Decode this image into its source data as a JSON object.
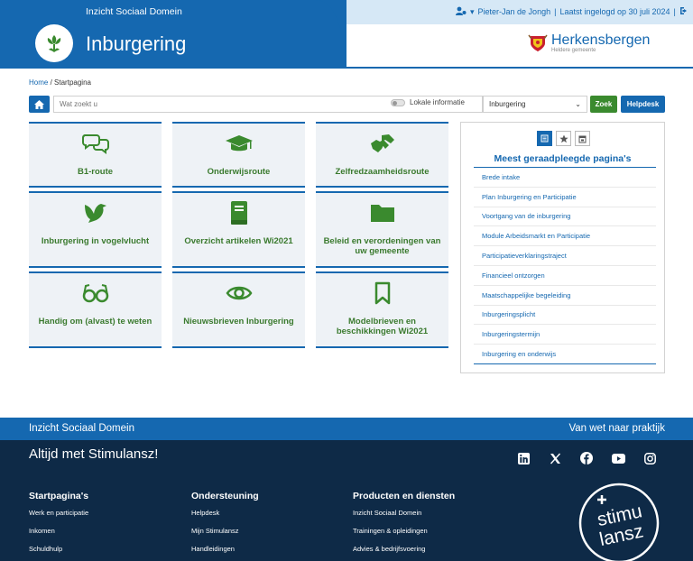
{
  "header": {
    "brand_top": "Inzicht Sociaal Domein",
    "app_title": "Inburgering",
    "user": "Pieter-Jan de Jongh",
    "separator": "|",
    "last_login": "Laatst ingelogd op 30 juli 2024",
    "municipality": "Herkensbergen",
    "municipality_tagline": "Heldere gemeente"
  },
  "breadcrumb": {
    "home": "Home",
    "sep": "/",
    "current": "Startpagina"
  },
  "search": {
    "placeholder": "Wat zoekt u",
    "toggle_label": "Lokale informatie",
    "select_value": "Inburgering",
    "search_button": "Zoek",
    "help_button": "Helpdesk"
  },
  "tiles": [
    {
      "label": "B1-route",
      "icon": "chat-icon"
    },
    {
      "label": "Onderwijsroute",
      "icon": "graduation-cap-icon"
    },
    {
      "label": "Zelfredzaamheidsroute",
      "icon": "handshake-icon"
    },
    {
      "label": "Inburgering in vogelvlucht",
      "icon": "dove-icon"
    },
    {
      "label": "Overzicht artikelen Wi2021",
      "icon": "book-icon"
    },
    {
      "label": "Beleid en verordeningen van uw gemeente",
      "icon": "folder-icon"
    },
    {
      "label": "Handig om (alvast) te weten",
      "icon": "glasses-icon"
    },
    {
      "label": "Nieuwsbrieven Inburgering",
      "icon": "eye-icon"
    },
    {
      "label": "Modelbrieven en beschikkingen Wi2021",
      "icon": "bookmark-icon"
    }
  ],
  "side_panel": {
    "title": "Meest geraadpleegde pagina's",
    "items": [
      "Brede intake",
      "Plan Inburgering en Participatie",
      "Voortgang van de inburgering",
      "Module Arbeidsmarkt en Participatie",
      "Participatieverklaringstraject",
      "Financieel ontzorgen",
      "Maatschappelijke begeleiding",
      "Inburgeringsplicht",
      "Inburgeringstermijn",
      "Inburgering en onderwijs"
    ]
  },
  "footer": {
    "bar_left": "Inzicht Sociaal Domein",
    "bar_right": "Van wet naar praktijk",
    "tagline": "Altijd met Stimulansz!",
    "columns": [
      {
        "title": "Startpagina's",
        "items": [
          "Werk en participatie",
          "Inkomen",
          "Schuldhulp"
        ]
      },
      {
        "title": "Ondersteuning",
        "items": [
          "Helpdesk",
          "Mijn Stimulansz",
          "Handleidingen"
        ]
      },
      {
        "title": "Producten en diensten",
        "items": [
          "Inzicht Sociaal Domein",
          "Trainingen & opleidingen",
          "Advies & bedrijfsvoering"
        ]
      }
    ],
    "logo_line1": "stimu",
    "logo_line2": "lansz"
  },
  "colors": {
    "primary": "#1568b0",
    "green": "#3a8a2e",
    "footer_dark": "#0e2a47",
    "tile_bg": "#eef2f6"
  }
}
